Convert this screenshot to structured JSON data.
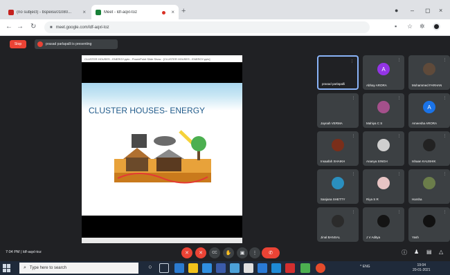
{
  "browser": {
    "tabs": [
      {
        "title": "(no subject) - bspeisu01080...",
        "favicon_color": "#c5221f",
        "active": false
      },
      {
        "title": "Meet - ldf-aqxl-toz",
        "favicon_color": "#188038",
        "active": true
      }
    ],
    "url": "meet.google.com/ldf-aqxl-toz",
    "new_tab_label": "+"
  },
  "meet": {
    "stop_button": "Stop",
    "presenting_banner": "prasad parlapalli is presenting",
    "slide_window_title": "CLUSTER HOUSES - ENERGY.pptx - PowerPoint  Slide Show - [CLUSTER HOUSES - ENERGY.pptx]",
    "slide_title": "CLUSTER HOUSES- ENERGY",
    "meeting_info": "7:04 PM  |  ldf-aqxl-toz",
    "participants": [
      {
        "name": "prasad parlapalli",
        "avatar_color": "#202124",
        "initial": "",
        "self": true
      },
      {
        "name": "Abhay ARORA",
        "avatar_color": "#9334e6",
        "initial": "A",
        "self": false
      },
      {
        "name": "Mohammed FARHAN",
        "avatar_color": "#5f4a3a",
        "initial": "",
        "self": false
      },
      {
        "name": "Jaynah VERMA",
        "avatar_color": "#3c4043",
        "initial": "",
        "self": false
      },
      {
        "name": "Mahiya C S",
        "avatar_color": "#a4508b",
        "initial": "",
        "self": false
      },
      {
        "name": "Ameesha ARORA",
        "avatar_color": "#1a73e8",
        "initial": "A",
        "self": false
      },
      {
        "name": "Insaafah SHAIKH",
        "avatar_color": "#7a2e1a",
        "initial": "",
        "self": false
      },
      {
        "name": "Ananya SINGH",
        "avatar_color": "#cfcfcf",
        "initial": "",
        "self": false
      },
      {
        "name": "Ishaan KAUSHIK",
        "avatar_color": "#222222",
        "initial": "",
        "self": false
      },
      {
        "name": "Sanjana SHETTY",
        "avatar_color": "#2a8fbf",
        "initial": "",
        "self": false
      },
      {
        "name": "Riya S R",
        "avatar_color": "#e8c4c4",
        "initial": "",
        "self": false
      },
      {
        "name": "Harsha",
        "avatar_color": "#6b7d4a",
        "initial": "",
        "self": false
      },
      {
        "name": "Jinal BANSAL",
        "avatar_color": "#2b2b2b",
        "initial": "",
        "self": false
      },
      {
        "name": "J V Aditya",
        "avatar_color": "#141414",
        "initial": "",
        "self": false
      },
      {
        "name": "Yash",
        "avatar_color": "#111111",
        "initial": "",
        "self": false
      }
    ]
  },
  "taskbar": {
    "search_placeholder": "Type here to search",
    "tray": "^  ENG",
    "time": "19:04",
    "date": "20-01-2021"
  },
  "icons": {
    "reload": "↻",
    "back": "←",
    "forward": "→",
    "lock": "🔒",
    "star": "☆",
    "menu": "⋮",
    "mic": "🎤",
    "camera": "■",
    "end_call": "✆",
    "hand": "✋",
    "cc": "CC",
    "present": "▣",
    "more": "⋮",
    "info": "ⓘ",
    "people": "👥",
    "chat": "▤",
    "activities": "△"
  },
  "colors": {
    "meet_bg": "#202124",
    "tile_bg": "#3c4043",
    "danger": "#ea4335",
    "self_outline": "#8ab4f8"
  }
}
